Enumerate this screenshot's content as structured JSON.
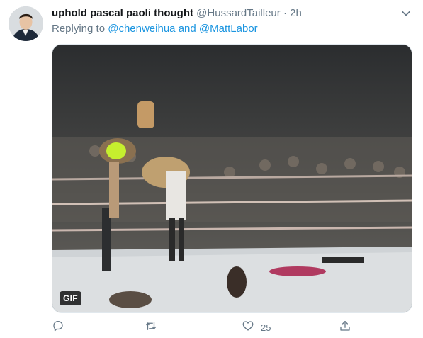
{
  "tweet": {
    "author_name": "uphold pascal paoli thought",
    "handle": "@HussardTailleur",
    "separator": "·",
    "time": "2h",
    "replying_prefix": "Replying to",
    "mention_1": "@chenweihua",
    "conjunction": "and",
    "mention_2": "@MattLabor",
    "media": {
      "badge": "GIF"
    },
    "actions": {
      "reply_icon": "reply-icon",
      "retweet_icon": "retweet-icon",
      "like_icon": "heart-icon",
      "like_count": "25",
      "share_icon": "share-icon"
    }
  },
  "colors": {
    "link": "#1b95e0",
    "muted": "#657786",
    "text": "#14171a"
  }
}
